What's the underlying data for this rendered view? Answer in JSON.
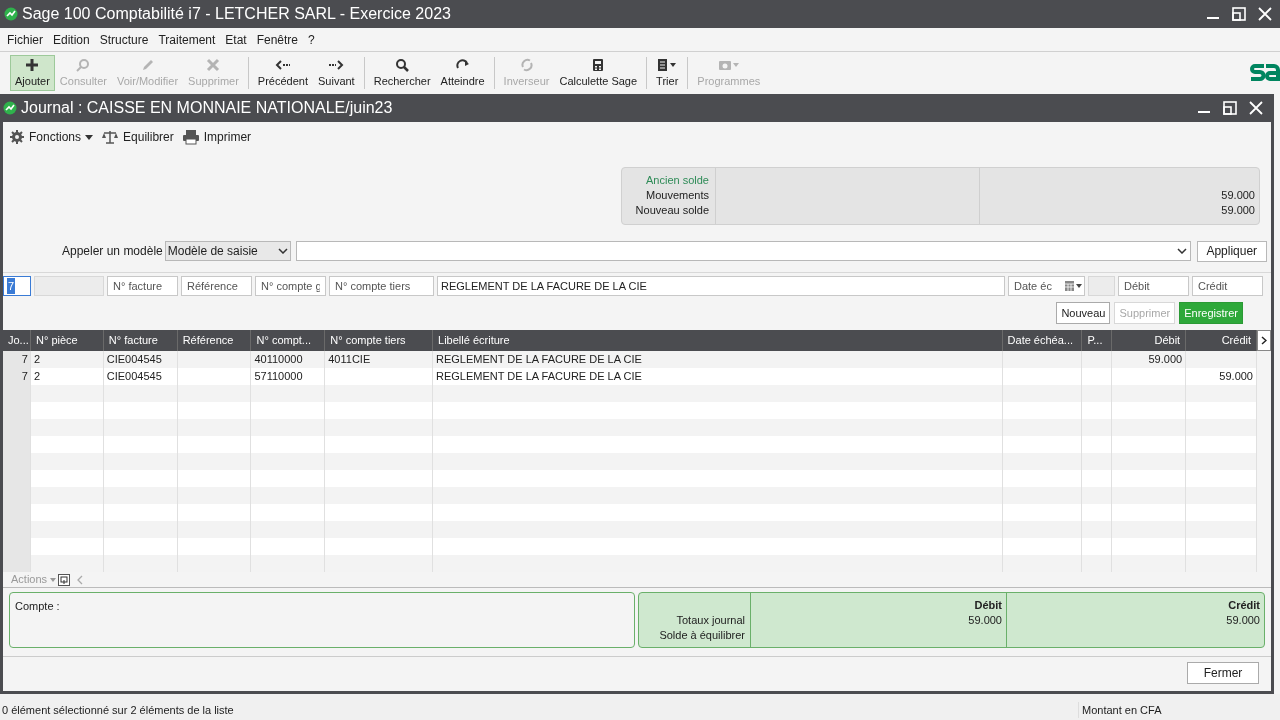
{
  "window": {
    "title": "Sage 100 Comptabilité i7 - LETCHER SARL - Exercice 2023"
  },
  "menu": [
    "Fichier",
    "Edition",
    "Structure",
    "Traitement",
    "Etat",
    "Fenêtre",
    "?"
  ],
  "toolbar": [
    {
      "label": "Ajouter",
      "disabled": false,
      "selected": true
    },
    {
      "label": "Consulter",
      "disabled": true,
      "selected": false
    },
    {
      "label": "Voir/Modifier",
      "disabled": true,
      "selected": false
    },
    {
      "label": "Supprimer",
      "disabled": true,
      "selected": false
    },
    {
      "label": "Précédent",
      "disabled": false,
      "selected": false
    },
    {
      "label": "Suivant",
      "disabled": false,
      "selected": false
    },
    {
      "label": "Rechercher",
      "disabled": false,
      "selected": false
    },
    {
      "label": "Atteindre",
      "disabled": false,
      "selected": false
    },
    {
      "label": "Inverseur",
      "disabled": true,
      "selected": false
    },
    {
      "label": "Calculette Sage",
      "disabled": false,
      "selected": false
    },
    {
      "label": "Trier",
      "disabled": false,
      "selected": false
    },
    {
      "label": "Programmes",
      "disabled": true,
      "selected": false
    }
  ],
  "journal": {
    "title": "Journal : CAISSE EN MONNAIE NATIONALE/juin23",
    "actions": [
      "Fonctions",
      "Equilibrer",
      "Imprimer"
    ],
    "solde": [
      {
        "label": "Ancien solde",
        "kind": "accent"
      },
      {
        "label": "Mouvements",
        "kind": "plain",
        "value": "59.000"
      },
      {
        "label": "Nouveau solde",
        "kind": "plain",
        "value": "59.000"
      }
    ],
    "model": {
      "label": "Appeler un modèle",
      "select": "Modèle de saisie",
      "button": "Appliquer"
    },
    "entry": [
      {
        "kind": "value",
        "text": "7",
        "selected": true
      },
      {
        "kind": "blank"
      },
      {
        "kind": "placeholder",
        "placeholder": "N° facture"
      },
      {
        "kind": "placeholder",
        "placeholder": "Référence"
      },
      {
        "kind": "placeholder",
        "placeholder": "N° compte g"
      },
      {
        "kind": "placeholder",
        "placeholder": "N° compte tiers"
      },
      {
        "kind": "value",
        "text": "REGLEMENT DE LA FACURE DE LA CIE",
        "selected": false
      },
      {
        "kind": "date",
        "placeholder": "Date éc"
      },
      {
        "kind": "blank"
      },
      {
        "kind": "placeholder",
        "placeholder": "Débit"
      },
      {
        "kind": "placeholder",
        "placeholder": "Crédit"
      }
    ],
    "buttons": [
      {
        "label": "Nouveau",
        "kind": "normal",
        "disabled": false
      },
      {
        "label": "Supprimer",
        "kind": "normal",
        "disabled": true
      },
      {
        "label": "Enregistrer",
        "kind": "primary",
        "disabled": false
      }
    ],
    "table": {
      "columns": [
        "Jo...",
        "N° pièce",
        "N° facture",
        "Référence",
        "N° compt...",
        "N° compte tiers",
        "Libellé écriture",
        "Date échéa...",
        "P...",
        "Débit",
        "Crédit"
      ],
      "rows": [
        [
          "7",
          "2",
          "CIE004545",
          "",
          "40110000",
          "4011CIE",
          "REGLEMENT DE LA FACURE DE LA CIE",
          "",
          "",
          "59.000",
          ""
        ],
        [
          "7",
          "2",
          "CIE004545",
          "",
          "57110000",
          "",
          "REGLEMENT DE LA FACURE DE LA CIE",
          "",
          "",
          "",
          "59.000"
        ]
      ]
    },
    "actions_menu": "Actions",
    "compte_label": "Compte :",
    "totals": {
      "labels": [
        "Totaux journal",
        "Solde à équilibrer"
      ],
      "debit": {
        "title": "Débit",
        "value": "59.000"
      },
      "credit": {
        "title": "Crédit",
        "value": "59.000"
      }
    },
    "close_button": "Fermer"
  },
  "status_bar": {
    "selection": "0 élément sélectionné sur 2 éléments de la liste",
    "currency": "Montant en CFA"
  }
}
